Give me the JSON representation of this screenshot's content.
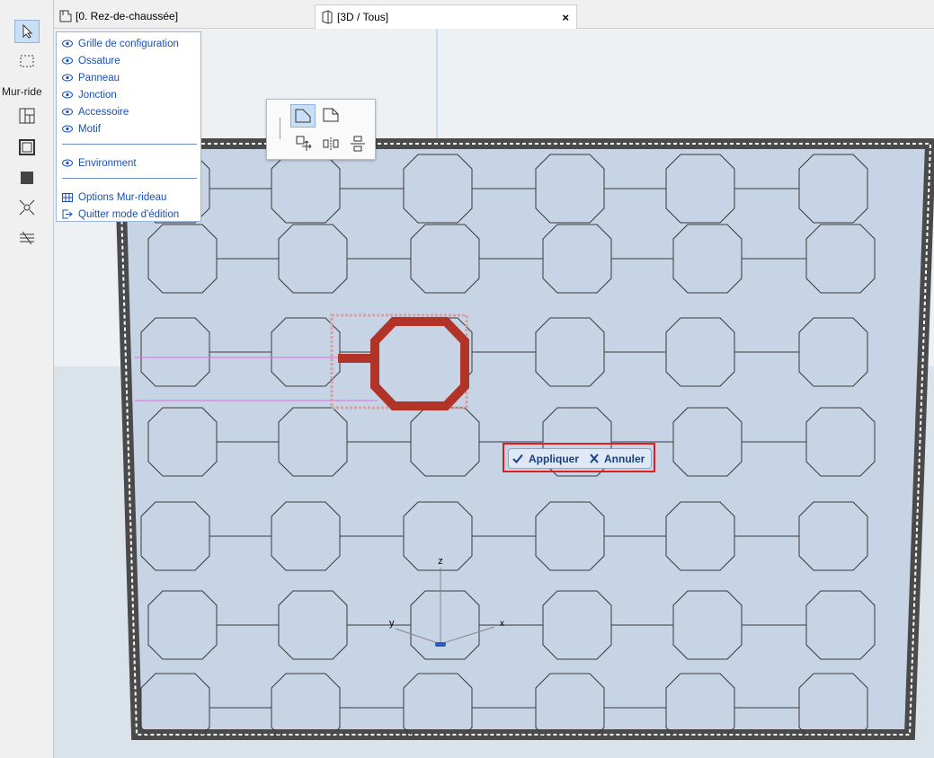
{
  "toolbox": {
    "section_label": "Mur-ride"
  },
  "tabs": [
    {
      "label": "[0. Rez-de-chaussée]"
    },
    {
      "label": "[3D / Tous]",
      "close": "×"
    }
  ],
  "menu": {
    "items": [
      {
        "label": "Grille de configuration",
        "icon": "eye-icon"
      },
      {
        "label": "Ossature",
        "icon": "eye-icon"
      },
      {
        "label": "Panneau",
        "icon": "eye-icon"
      },
      {
        "label": "Jonction",
        "icon": "eye-icon"
      },
      {
        "label": "Accessoire",
        "icon": "eye-icon"
      },
      {
        "label": "Motif",
        "icon": "eye-icon"
      },
      {
        "label": "Environment",
        "icon": "eye-icon"
      },
      {
        "label": "Options Mur-rideau",
        "icon": "grid-table-icon"
      },
      {
        "label": "Quitter mode d'édition",
        "icon": "exit-icon"
      }
    ]
  },
  "actions": {
    "apply": "Appliquer",
    "cancel": "Annuler"
  },
  "axes": {
    "z": "z",
    "y": "y",
    "x": "x"
  },
  "colors": {
    "accent": "#2a5cc4",
    "highlight_frame": "#e21d1d",
    "selected_panel": "#b23327",
    "wall_glass": "#c6d4e6",
    "wall_frame": "#4a4a4a"
  }
}
